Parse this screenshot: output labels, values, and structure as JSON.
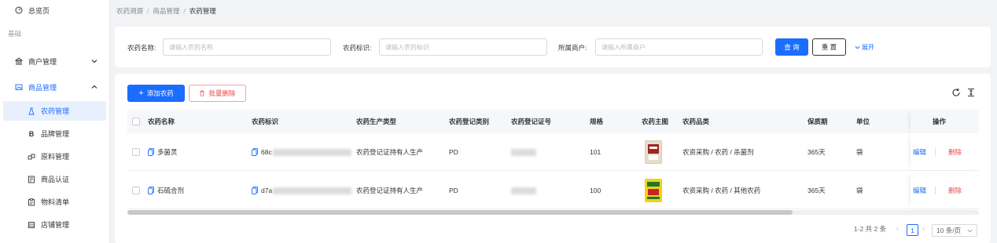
{
  "sidebar": {
    "overview": "总览页",
    "group": "基础",
    "menus": [
      {
        "label": "商户管理"
      },
      {
        "label": "商品管理"
      }
    ],
    "subitems": [
      {
        "label": "农药管理"
      },
      {
        "label": "品牌管理",
        "glyph": "B"
      },
      {
        "label": "原料管理"
      },
      {
        "label": "商品认证"
      },
      {
        "label": "物料清单"
      },
      {
        "label": "店铺管理"
      }
    ]
  },
  "breadcrumb": [
    "农药溯源",
    "商品管理",
    "农药管理"
  ],
  "search": {
    "name_label": "农药名称:",
    "name_placeholder": "请输入农药名称",
    "id_label": "农药标识:",
    "id_placeholder": "请输入农药标识",
    "merchant_label": "所属商户:",
    "merchant_placeholder": "请输入所属商户",
    "query": "查 询",
    "reset": "重 置",
    "expand": "展开"
  },
  "toolbar": {
    "add": "添加农药",
    "batch_delete": "批量删除"
  },
  "table": {
    "columns": [
      "农药名称",
      "农药标识",
      "农药生产类型",
      "农药登记类别",
      "农药登记证号",
      "规格",
      "农药主图",
      "农药品类",
      "保质期",
      "单位",
      "操作"
    ],
    "rows": [
      {
        "name": "多菌灵",
        "id_prefix": "68c",
        "production_type": "农药登记证持有人生产",
        "registration_category": "PD",
        "spec": "101",
        "category": "农资采购 / 农药 / 杀菌剂",
        "shelf_life": "365天",
        "unit": "袋",
        "edit": "编辑",
        "delete": "删除",
        "thumb_color": "#d9c9b8"
      },
      {
        "name": "石硫合剂",
        "id_prefix": "d7a",
        "production_type": "农药登记证持有人生产",
        "registration_category": "PD",
        "spec": "100",
        "category": "农资采购 / 农药 / 其他农药",
        "shelf_life": "365天",
        "unit": "袋",
        "edit": "编辑",
        "delete": "删除",
        "thumb_color": "#f2d21a"
      }
    ]
  },
  "pagination": {
    "summary": "1-2 共 2 条",
    "current": "1",
    "page_size": "10 条/页"
  },
  "colors": {
    "primary": "#1a6dff",
    "danger": "#f04848"
  }
}
